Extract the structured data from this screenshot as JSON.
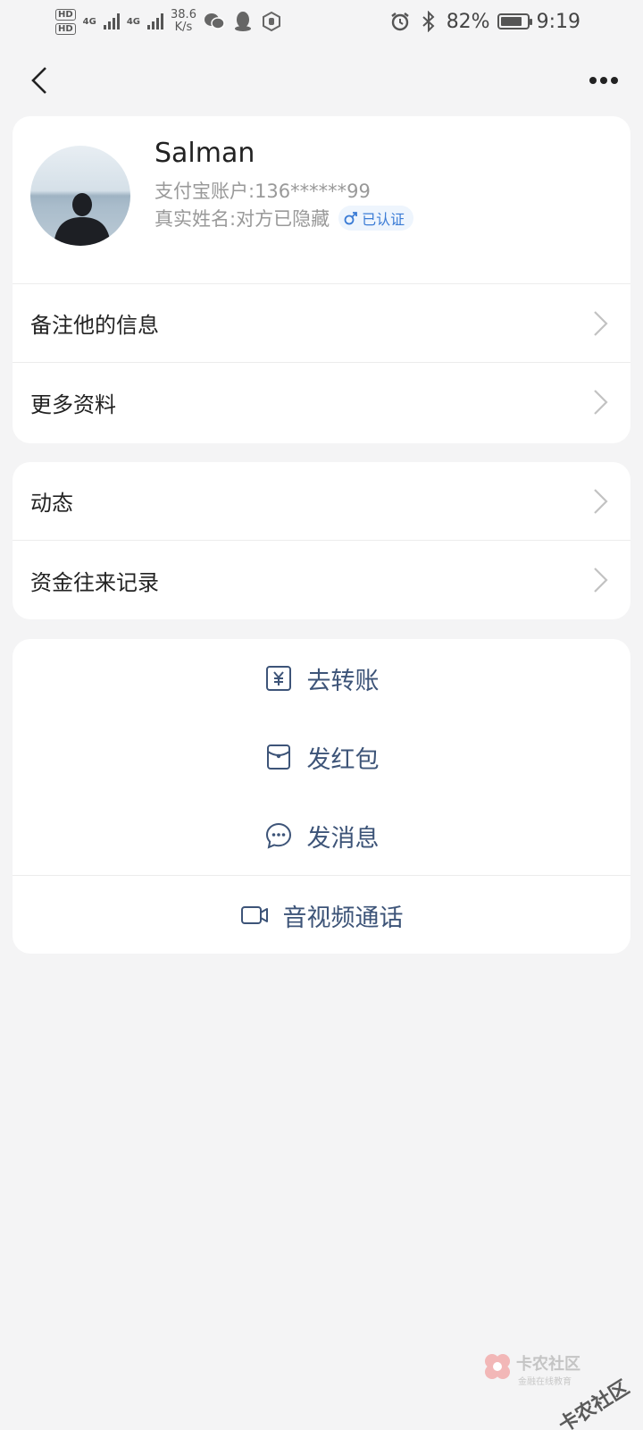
{
  "status_bar": {
    "hd1": "HD",
    "hd2": "HD",
    "net1": "4G",
    "net2": "4G",
    "speed_value": "38.6",
    "speed_unit": "K/s",
    "battery_pct": "82%",
    "time": "9:19",
    "battery_level": 0.82
  },
  "header": {
    "back_icon": "chevron-left-icon",
    "more_icon": "more-dots-icon"
  },
  "profile": {
    "name": "Salman",
    "account": "支付宝账户:136******99",
    "real_name": "真实姓名:对方已隐藏",
    "verified_badge": "已认证",
    "gender_icon": "male-icon"
  },
  "info_rows": [
    {
      "label": "备注他的信息"
    },
    {
      "label": "更多资料"
    }
  ],
  "activity_rows": [
    {
      "label": "动态"
    },
    {
      "label": "资金往来记录"
    }
  ],
  "actions": [
    {
      "label": "去转账",
      "icon": "transfer-yuan-icon"
    },
    {
      "label": "发红包",
      "icon": "red-envelope-icon"
    },
    {
      "label": "发消息",
      "icon": "message-bubble-icon"
    },
    {
      "label": "音视频通话",
      "icon": "video-call-icon"
    }
  ],
  "watermark": {
    "title": "卡农社区",
    "subtitle": "金融在线教育",
    "tilted": "卡农社区"
  },
  "colors": {
    "background": "#f4f4f5",
    "card": "#ffffff",
    "action_text": "#3d5478",
    "verified_text": "#3a7bd5",
    "verified_bg": "#eef5fd"
  }
}
